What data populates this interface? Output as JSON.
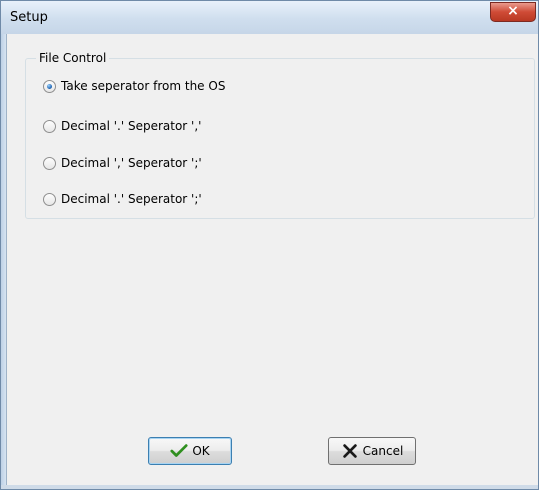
{
  "window": {
    "title": "Setup",
    "close_glyph": "×"
  },
  "file_control": {
    "group_label": "File Control",
    "options": [
      {
        "label": "Take seperator from the OS",
        "checked": true
      },
      {
        "label": "Decimal '.' Seperator ','",
        "checked": false
      },
      {
        "label": "Decimal ',' Seperator ';'",
        "checked": false
      },
      {
        "label": "Decimal '.' Seperator ';'",
        "checked": false
      }
    ]
  },
  "buttons": {
    "ok": {
      "label": "OK",
      "icon": "checkmark-icon",
      "color": "#2f8f1f"
    },
    "cancel": {
      "label": "Cancel",
      "icon": "x-icon",
      "color": "#1a1a1a"
    }
  }
}
